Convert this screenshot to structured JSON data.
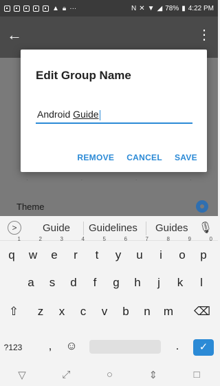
{
  "status": {
    "battery": "78%",
    "time": "4:22 PM",
    "icons": [
      "notification-icon",
      "notification-icon",
      "notification-icon",
      "notification-icon",
      "notification-icon",
      "warning-icon",
      "lock-icon",
      "more-icon",
      "nfc-icon",
      "mute-icon",
      "wifi-icon",
      "signal-icon",
      "battery-icon"
    ]
  },
  "appbar": {
    "back_icon": "←",
    "more_icon": "⋮"
  },
  "background": {
    "theme_label": "Theme"
  },
  "dialog": {
    "title": "Edit Group Name",
    "input_prefix": "Android ",
    "input_suffix": "Guide",
    "actions": {
      "remove": "REMOVE",
      "cancel": "CANCEL",
      "save": "SAVE"
    }
  },
  "suggestions": {
    "expand_icon": ">",
    "items": [
      "Guide",
      "Guidelines",
      "Guides"
    ],
    "mic_icon": "🎙"
  },
  "keyboard": {
    "row1": [
      {
        "k": "q",
        "n": "1"
      },
      {
        "k": "w",
        "n": "2"
      },
      {
        "k": "e",
        "n": "3"
      },
      {
        "k": "r",
        "n": "4"
      },
      {
        "k": "t",
        "n": "5"
      },
      {
        "k": "y",
        "n": "6"
      },
      {
        "k": "u",
        "n": "7"
      },
      {
        "k": "i",
        "n": "8"
      },
      {
        "k": "o",
        "n": "9"
      },
      {
        "k": "p",
        "n": "0"
      }
    ],
    "row2": [
      "a",
      "s",
      "d",
      "f",
      "g",
      "h",
      "j",
      "k",
      "l"
    ],
    "row3": [
      "⇧",
      "z",
      "x",
      "c",
      "v",
      "b",
      "n",
      "m",
      "⌫"
    ],
    "row4": {
      "symbols": "?123",
      "comma": ",",
      "emoji": "☺",
      "period": ".",
      "enter": "✓"
    }
  },
  "navbar": {
    "back": "▽",
    "rotate": "⤢",
    "home": "○",
    "recents_split": "⇕",
    "recents": "□"
  }
}
